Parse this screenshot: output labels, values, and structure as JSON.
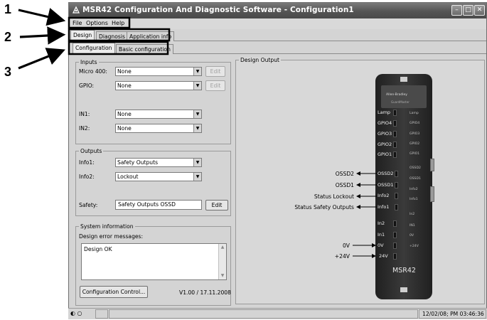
{
  "callouts": [
    "1",
    "2",
    "3"
  ],
  "window": {
    "title": "MSR42 Configuration And Diagnostic Software - Configuration1",
    "controls": {
      "minimize": "–",
      "maximize": "□",
      "close": "✕"
    }
  },
  "menu": [
    "File",
    "Options",
    "Help"
  ],
  "tabs_top": [
    "Design",
    "Diagnosis",
    "Application info"
  ],
  "tabs_sub": [
    "Configuration",
    "Basic configuration"
  ],
  "inputs": {
    "legend": "Inputs",
    "rows": [
      {
        "label": "Micro 400:",
        "value": "None",
        "button": "Edit"
      },
      {
        "label": "GPIO:",
        "value": "None",
        "button": "Edit"
      },
      {
        "label": "IN1:",
        "value": "None"
      },
      {
        "label": "IN2:",
        "value": "None"
      }
    ]
  },
  "outputs": {
    "legend": "Outputs",
    "rows": [
      {
        "label": "Info1:",
        "value": "Safety Outputs"
      },
      {
        "label": "Info2:",
        "value": "Lockout"
      }
    ],
    "safety": {
      "label": "Safety:",
      "value": "Safety Outputs OSSD",
      "button": "Edit"
    }
  },
  "system": {
    "legend": "System information",
    "messages_label": "Design error messages:",
    "messages": "Design OK",
    "scroll_up": "▲",
    "scroll_down": "▼",
    "config_button": "Configuration Control...",
    "version": "V1.00 / 17.11.2008"
  },
  "design_output": {
    "legend": "Design Output",
    "device": {
      "brand": "Allen-Bradley",
      "brand_sub": "GuardMaster",
      "model": "MSR42",
      "left_terminals": [
        "Lamp",
        "GPIO4",
        "GPIO3",
        "GPIO2",
        "GPIO1",
        "OSSD2",
        "OSSD1",
        "Info2",
        "Info1",
        "In2",
        "In1",
        "0V",
        "24V"
      ],
      "right_terminals": [
        "Lamp",
        "GPIO4",
        "GPIO3",
        "GPIO2",
        "GPIO1",
        "OSSD2",
        "OSSD1",
        "Info2",
        "Info1",
        "In2",
        "IN1",
        "0V",
        "+24V"
      ]
    },
    "signals_out": [
      "OSSD2",
      "OSSD1",
      "Status Lockout",
      "Status Safety Outputs"
    ],
    "signals_in": [
      "0V",
      "+24V"
    ]
  },
  "statusbar": {
    "datetime": "12/02/08; PM 03:46:36"
  }
}
